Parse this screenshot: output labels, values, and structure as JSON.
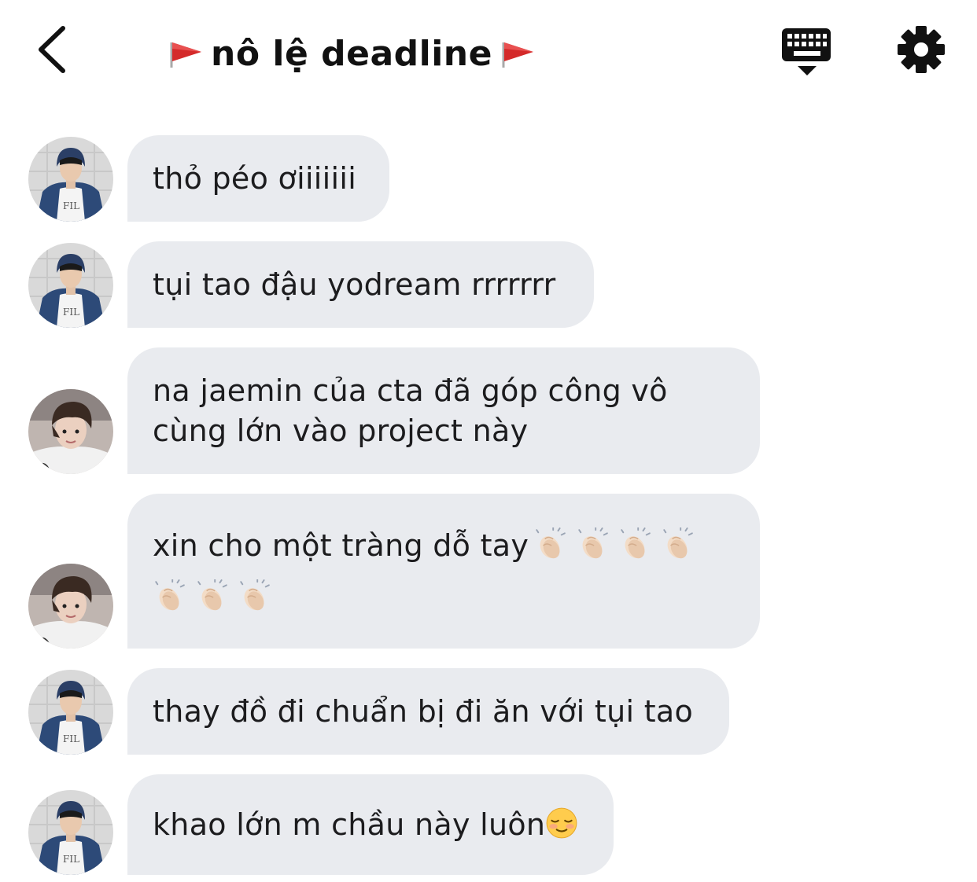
{
  "header": {
    "title": "nô lệ deadline",
    "back_icon": "chevron-left-icon",
    "keyboard_icon": "keyboard-icon",
    "settings_icon": "gear-icon",
    "flag_icon": "triangular-flag-icon"
  },
  "colors": {
    "bubble_bg": "#e9ebef",
    "text": "#1c1c1e",
    "flag_red": "#d42a2a"
  },
  "messages": [
    {
      "avatar": "avatar-hooded-boy",
      "text": "thỏ péo ơiiiiiii"
    },
    {
      "avatar": "avatar-hooded-boy",
      "text": "tụi tao đậu yodream rrrrrrr"
    },
    {
      "avatar": "avatar-selfie-boy",
      "text": "na jaemin của cta đã góp công vô cùng lớn vào project này"
    },
    {
      "avatar": "avatar-selfie-boy",
      "text": "xin cho một tràng dỗ tay",
      "emoji": "clapping-hands-icon",
      "emoji_count": 7
    },
    {
      "avatar": "avatar-hooded-boy",
      "text": "thay đồ đi chuẩn bị đi ăn với tụi tao"
    },
    {
      "avatar": "avatar-hooded-boy",
      "text": "khao lớn m chầu này luôn",
      "emoji": "relieved-face-icon"
    }
  ]
}
